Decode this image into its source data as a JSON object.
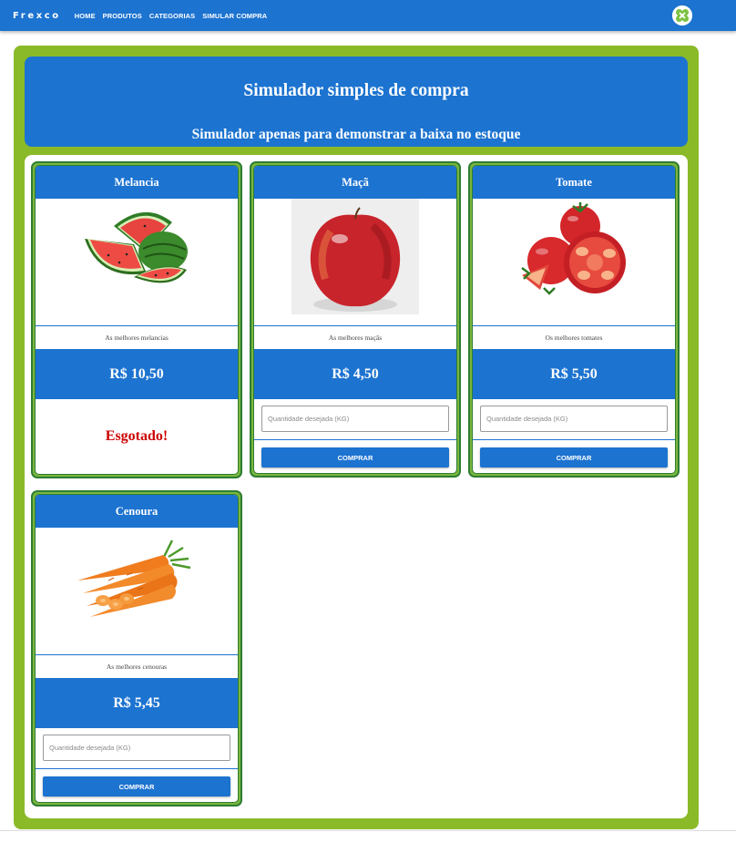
{
  "navbar": {
    "brand": "Frexco",
    "links": [
      "HOME",
      "PRODUTOS",
      "CATEGORIAS",
      "SIMULAR COMPRA"
    ],
    "logo_icon": "clover-logo-icon",
    "color": "#1c73d0"
  },
  "hero": {
    "title": "Simulador simples de compra",
    "subtitle": "Simulador apenas para demonstrar a baixa no estoque"
  },
  "colors": {
    "primary": "#1c73d0",
    "frame_green": "#8aba28",
    "card_border": "#2e7d32",
    "soldout_red": "#cc0000"
  },
  "products": [
    {
      "name": "Melancia",
      "image_icon": "watermelon-image",
      "description": "As melhores melancias",
      "price": "R$ 10,50",
      "sold_out": true,
      "sold_out_label": "Esgotado!"
    },
    {
      "name": "Maçã",
      "image_icon": "apple-image",
      "description": "As melhores maçãs",
      "price": "R$ 4,50",
      "sold_out": false,
      "qty_placeholder": "Quantidade desejada (KG)",
      "qty_value": "",
      "buy_label": "COMPRAR"
    },
    {
      "name": "Tomate",
      "image_icon": "tomato-image",
      "description": "Os melhores tomates",
      "price": "R$ 5,50",
      "sold_out": false,
      "qty_placeholder": "Quantidade desejada (KG)",
      "qty_value": "",
      "buy_label": "COMPRAR"
    },
    {
      "name": "Cenoura",
      "image_icon": "carrot-image",
      "description": "As melhores cenouras",
      "price": "R$ 5,45",
      "sold_out": false,
      "qty_placeholder": "Quantidade desejada (KG)",
      "qty_value": "",
      "buy_label": "COMPRAR"
    }
  ]
}
